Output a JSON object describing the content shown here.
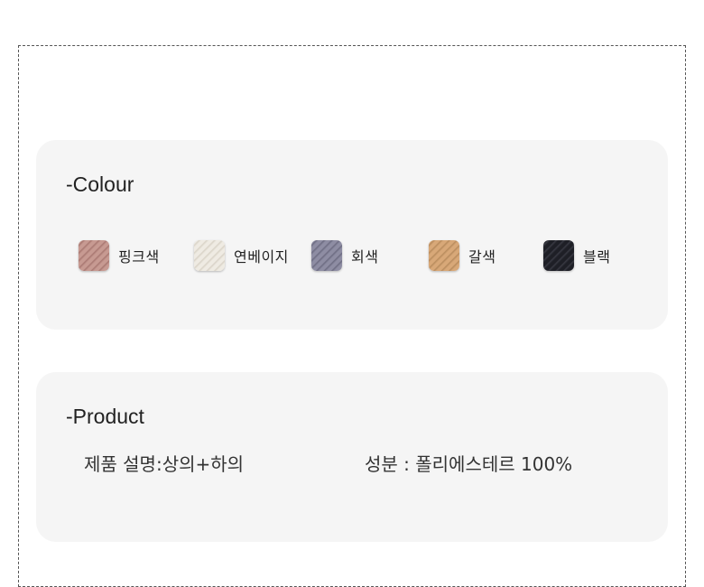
{
  "colour_section": {
    "title": "-Colour",
    "swatches": [
      {
        "label": "핑크색",
        "color": "#c79a92",
        "stripe": "#a77670"
      },
      {
        "label": "연베이지",
        "color": "#efebe3",
        "stripe": "#d8d2c6"
      },
      {
        "label": "회색",
        "color": "#8e8da3",
        "stripe": "#6b6a80"
      },
      {
        "label": "갈색",
        "color": "#d8a878",
        "stripe": "#b78a5c"
      },
      {
        "label": "블랙",
        "color": "#1e1f26",
        "stripe": "#3a3b44"
      }
    ]
  },
  "product_section": {
    "title": "-Product",
    "description": "제품 설명:상의+하의",
    "material": "성분 : 폴리에스테르 100%"
  }
}
